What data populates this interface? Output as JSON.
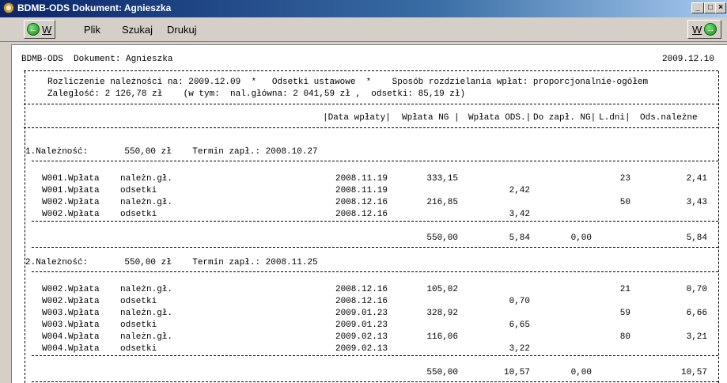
{
  "window": {
    "title": "BDMB-ODS  Dokument: Agnieszka",
    "min_glyph": "_",
    "max_glyph": "□",
    "close_glyph": "×"
  },
  "toolbar": {
    "back_label": "W",
    "forward_label": "W",
    "back_icon_glyph": "←",
    "forward_icon_glyph": "→",
    "menu": [
      "Plik",
      "Szukaj",
      "Drukuj"
    ]
  },
  "doc": {
    "header_left": "BDMB-ODS  Dokument: Agnieszka",
    "header_right": "2009.12.10",
    "summary_line1": "Rozliczenie należności na: 2009.12.09  *   Odsetki ustawowe  *    Sposób rozdzielania wpłat: proporcjonalnie-ogółem",
    "summary_line2": "Zaległość: 2 126,78 zł    (w tym:  nal.główna: 2 041,59 zł ,  odsetki: 85,19 zł)",
    "columns": [
      "|Data wpłaty|",
      "Wpłata NG |",
      "Wpłata ODS.|",
      "Do zapł. NG|",
      "L.dni|",
      "Ods.należne"
    ],
    "sections": [
      {
        "title": "1.Należność:       550,00 zł    Termin zapł.: 2008.10.27",
        "rows": [
          {
            "doc": "W001.Wpłata",
            "type": "należn.gł.",
            "date": "2008.11.19",
            "ng": "333,15",
            "ods": "",
            "dni": "23",
            "odsnal": "2,41"
          },
          {
            "doc": "W001.Wpłata",
            "type": "odsetki",
            "date": "2008.11.19",
            "ng": "",
            "ods": "2,42",
            "dni": "",
            "odsnal": ""
          },
          {
            "doc": "W002.Wpłata",
            "type": "należn.gł.",
            "date": "2008.12.16",
            "ng": "216,85",
            "ods": "",
            "dni": "50",
            "odsnal": "3,43"
          },
          {
            "doc": "W002.Wpłata",
            "type": "odsetki",
            "date": "2008.12.16",
            "ng": "",
            "ods": "3,42",
            "dni": "",
            "odsnal": ""
          }
        ],
        "totals": {
          "ng": "550,00",
          "ods": "5,84",
          "doz": "0,00",
          "odsnal": "5,84"
        }
      },
      {
        "title": "2.Należność:       550,00 zł    Termin zapł.: 2008.11.25",
        "rows": [
          {
            "doc": "W002.Wpłata",
            "type": "należn.gł.",
            "date": "2008.12.16",
            "ng": "105,02",
            "ods": "",
            "dni": "21",
            "odsnal": "0,70"
          },
          {
            "doc": "W002.Wpłata",
            "type": "odsetki",
            "date": "2008.12.16",
            "ng": "",
            "ods": "0,70",
            "dni": "",
            "odsnal": ""
          },
          {
            "doc": "W003.Wpłata",
            "type": "należn.gł.",
            "date": "2009.01.23",
            "ng": "328,92",
            "ods": "",
            "dni": "59",
            "odsnal": "6,66"
          },
          {
            "doc": "W003.Wpłata",
            "type": "odsetki",
            "date": "2009.01.23",
            "ng": "",
            "ods": "6,65",
            "dni": "",
            "odsnal": ""
          },
          {
            "doc": "W004.Wpłata",
            "type": "należn.gł.",
            "date": "2009.02.13",
            "ng": "116,06",
            "ods": "",
            "dni": "80",
            "odsnal": "3,21"
          },
          {
            "doc": "W004.Wpłata",
            "type": "odsetki",
            "date": "2009.02.13",
            "ng": "",
            "ods": "3,22",
            "dni": "",
            "odsnal": ""
          }
        ],
        "totals": {
          "ng": "550,00",
          "ods": "10,57",
          "doz": "0,00",
          "odsnal": "10,57"
        }
      }
    ]
  }
}
